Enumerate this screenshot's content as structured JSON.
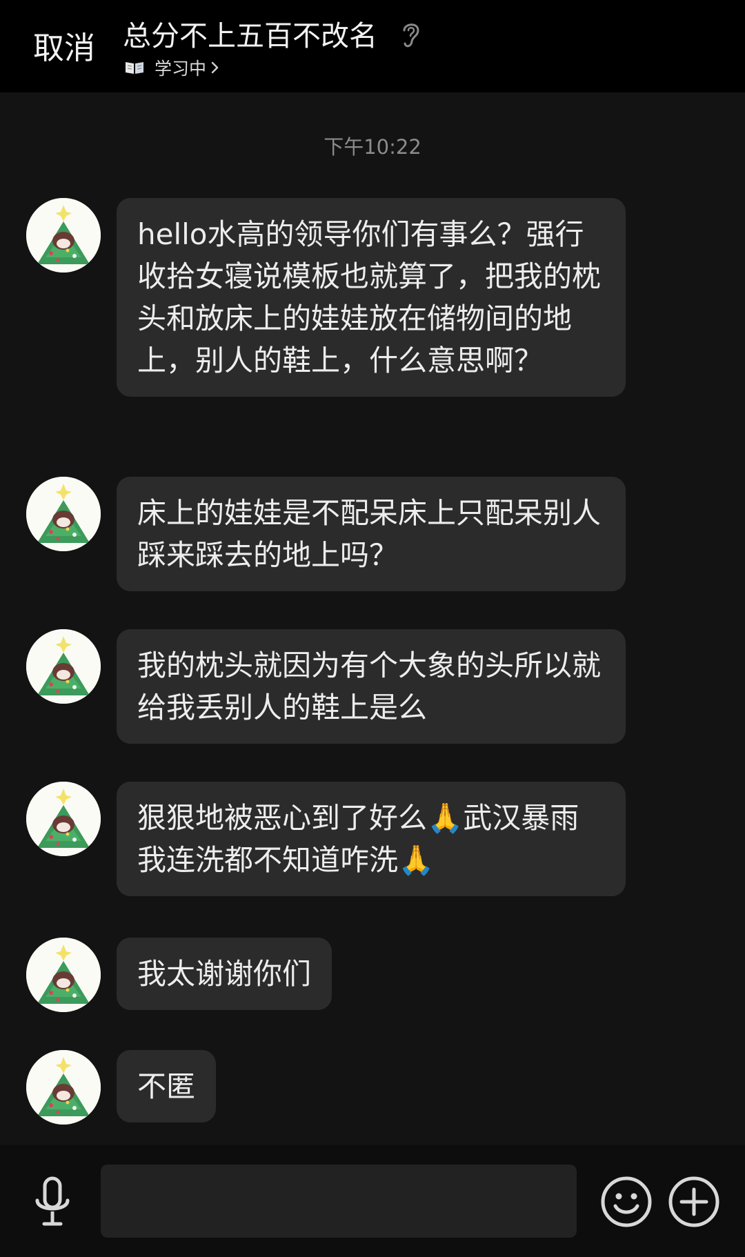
{
  "header": {
    "cancel_label": "取消",
    "chat_title": "总分不上五百不改名",
    "status_text": "学习中"
  },
  "timestamp": "下午10:22",
  "messages": [
    {
      "text": "hello水高的领导你们有事么？强行收拾女寝说模板也就算了，把我的枕头和放床上的娃娃放在储物间的地上，别人的鞋上，什么意思啊？"
    },
    {
      "text": "床上的娃娃是不配呆床上只配呆别人踩来踩去的地上吗？"
    },
    {
      "text": "我的枕头就因为有个大象的头所以就给我丢别人的鞋上是么"
    },
    {
      "text": "狠狠地被恶心到了好么🙏武汉暴雨我连洗都不知道咋洗🙏"
    },
    {
      "text": "我太谢谢你们"
    },
    {
      "text": "不匿"
    }
  ],
  "composer": {
    "placeholder": ""
  },
  "icons": {
    "ear": "ear-icon",
    "book": "book-icon",
    "chevron": "chevron-right-icon",
    "mic": "microphone-icon",
    "emoji": "emoji-icon",
    "plus": "plus-icon"
  },
  "colors": {
    "background": "#131313",
    "header": "#000000",
    "bubble": "#2b2b2b",
    "text": "#ededed",
    "timestamp": "#8c8c8c"
  }
}
